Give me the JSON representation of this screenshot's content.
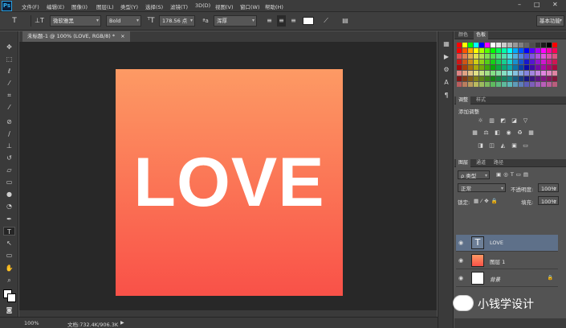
{
  "menubar": {
    "logo": "Ps",
    "items": [
      "文件(F)",
      "编辑(E)",
      "图像(I)",
      "图层(L)",
      "类型(Y)",
      "选择(S)",
      "滤镜(T)",
      "3D(D)",
      "视图(V)",
      "窗口(W)",
      "帮助(H)"
    ]
  },
  "options": {
    "font_family": "微软雅黑",
    "font_style": "Bold",
    "font_size": "178.56 点",
    "anti_alias": "浑厚",
    "workspace": "基本功能"
  },
  "document": {
    "tab_title": "未标题-1 @ 100% (LOVE, RGB/8) *",
    "text": "LOVE",
    "gradient_top": "#fd9a64",
    "gradient_bottom": "#f95148"
  },
  "status": {
    "zoom": "100%",
    "doc_size": "文档:732.4K/906.3K"
  },
  "panels": {
    "color_tabs": [
      "颜色",
      "色板"
    ],
    "adjust_tabs": [
      "调整",
      "样式"
    ],
    "adjust_label": "添加调整",
    "layer_tabs": [
      "图层",
      "通道",
      "路径"
    ],
    "filter_kind": "ρ 类型",
    "blend_mode": "正常",
    "opacity_label": "不透明度:",
    "opacity_value": "100%",
    "lock_label": "锁定:",
    "fill_label": "填充:",
    "fill_value": "100%",
    "layers": [
      {
        "name": "LOVE",
        "type": "text"
      },
      {
        "name": "图层 1",
        "type": "gradient"
      },
      {
        "name": "背景",
        "type": "background"
      }
    ]
  },
  "watermark": {
    "text": "小钱学设计"
  }
}
